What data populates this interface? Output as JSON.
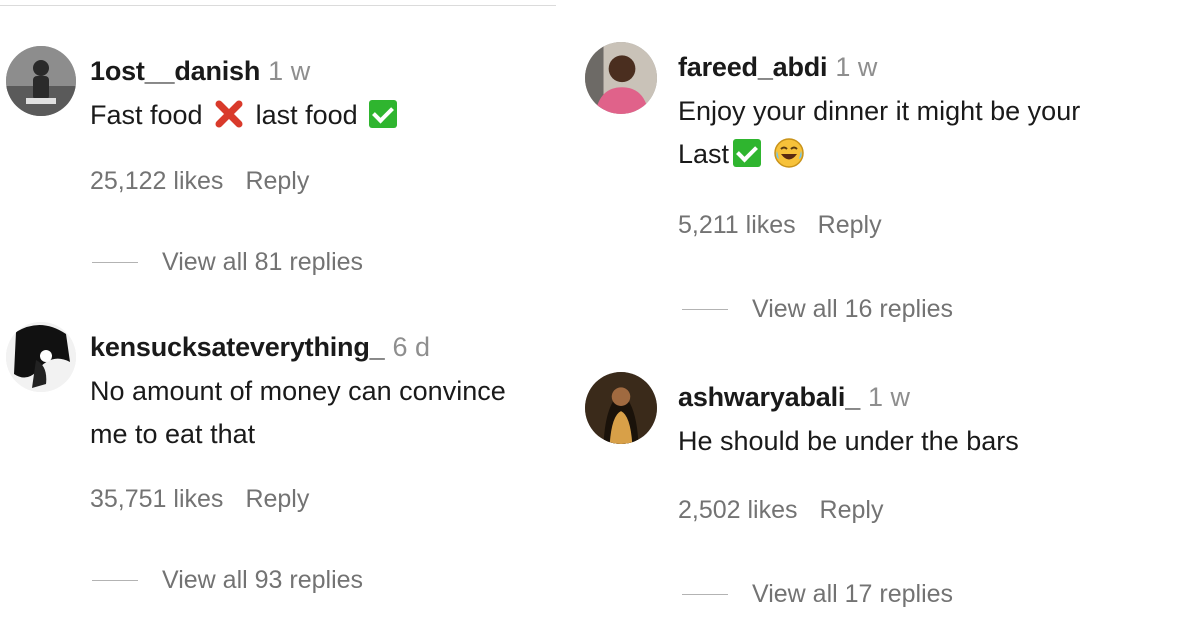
{
  "comments": [
    {
      "username": "1ost__danish",
      "time": "1 w",
      "text_before": "Fast food",
      "text_middle": "last food",
      "likes": "25,122 likes",
      "reply": "Reply",
      "view_replies": "View all 81 replies",
      "avatar_icon": "avatar-photo-icon"
    },
    {
      "username": "kensucksateverything_",
      "time": "6 d",
      "text_line1": "No amount of money can convince",
      "text_line2": "me to eat that",
      "likes": "35,751 likes",
      "reply": "Reply",
      "view_replies": "View all 93 replies",
      "avatar_icon": "avatar-photo-icon"
    },
    {
      "username": "fareed_abdi",
      "time": "1 w",
      "text_line1": "Enjoy your dinner it might be your",
      "text_line2": "Last",
      "likes": "5,211 likes",
      "reply": "Reply",
      "view_replies": "View all 16 replies",
      "avatar_icon": "avatar-photo-icon"
    },
    {
      "username": "ashwaryabali_",
      "time": "1 w",
      "text": "He should be under the bars",
      "likes": "2,502 likes",
      "reply": "Reply",
      "view_replies": "View all 17 replies",
      "avatar_icon": "avatar-photo-icon"
    }
  ],
  "icons": {
    "cross": "cross-mark-icon",
    "check": "check-mark-icon",
    "laugh": "laughing-face-icon"
  },
  "colors": {
    "username": "#1a1a1a",
    "muted": "#737373",
    "check_green": "#2fb52f",
    "cross_red": "#d93a2b"
  }
}
